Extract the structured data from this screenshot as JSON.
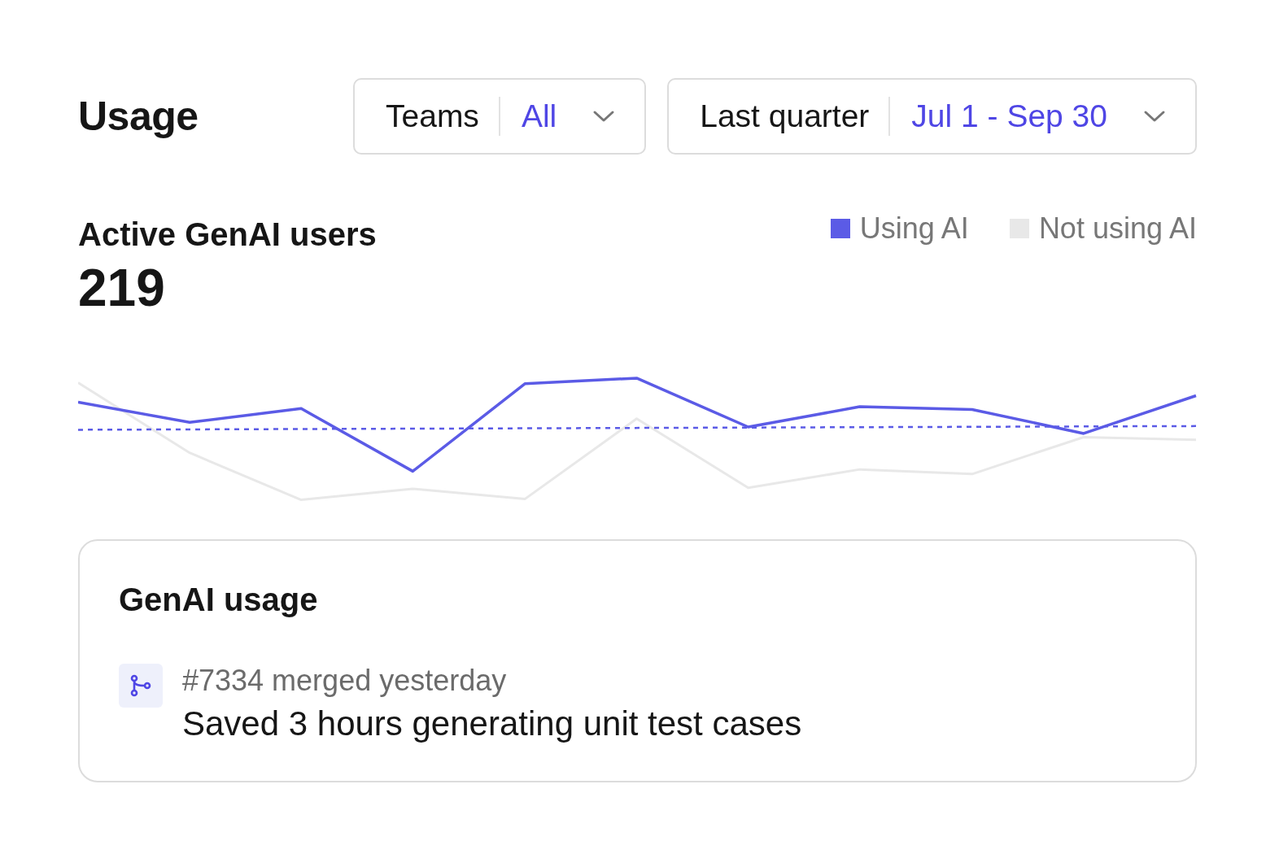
{
  "header": {
    "title": "Usage",
    "filters": [
      {
        "label": "Teams",
        "value": "All"
      },
      {
        "label": "Last quarter",
        "value": "Jul 1 - Sep 30"
      }
    ]
  },
  "metric": {
    "title": "Active GenAI users",
    "value": "219",
    "legend": [
      {
        "label": "Using AI",
        "color": "#5b5be6"
      },
      {
        "label": "Not using AI",
        "color": "#e8e8e8"
      }
    ]
  },
  "card": {
    "title": "GenAI usage",
    "items": [
      {
        "meta": "#7334 merged yesterday",
        "text": "Saved 3 hours generating unit test cases"
      }
    ]
  }
}
